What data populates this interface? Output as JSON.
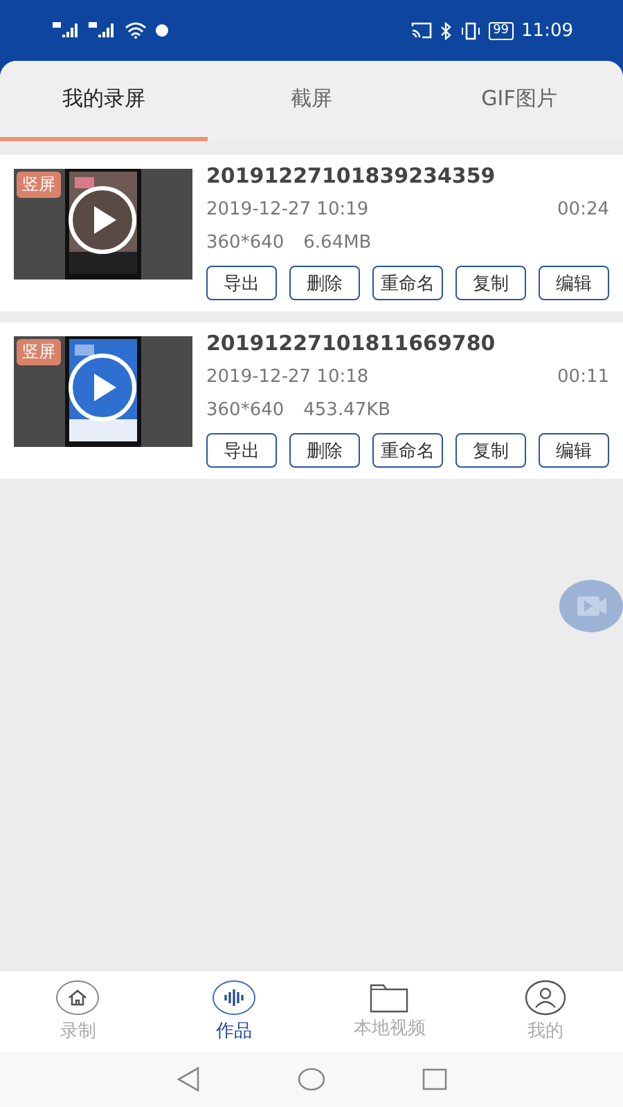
{
  "status_bar": {
    "battery": "99",
    "time": "11:09"
  },
  "tabs": [
    {
      "label": "我的录屏",
      "selected": true
    },
    {
      "label": "截屏",
      "selected": false
    },
    {
      "label": "GIF图片",
      "selected": false
    }
  ],
  "recordings": [
    {
      "badge": "竖屏",
      "name": "20191227101839234359",
      "date": "2019-12-27 10:19",
      "duration": "00:24",
      "resolution": "360*640",
      "size": "6.64MB",
      "actions": [
        "导出",
        "删除",
        "重命名",
        "复制",
        "编辑"
      ]
    },
    {
      "badge": "竖屏",
      "name": "20191227101811669780",
      "date": "2019-12-27 10:18",
      "duration": "00:11",
      "resolution": "360*640",
      "size": "453.47KB",
      "actions": [
        "导出",
        "删除",
        "重命名",
        "复制",
        "编辑"
      ]
    }
  ],
  "bottom_nav": [
    {
      "kind": "home",
      "label": "录制",
      "selected": false
    },
    {
      "kind": "wave",
      "label": "作品",
      "selected": true
    },
    {
      "kind": "folder",
      "label": "本地视频",
      "selected": false
    },
    {
      "kind": "user",
      "label": "我的",
      "selected": false
    }
  ]
}
